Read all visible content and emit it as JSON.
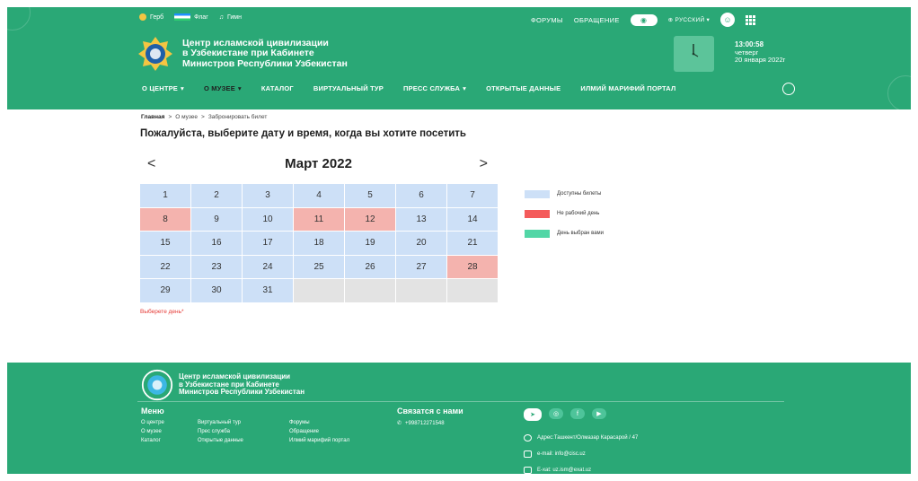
{
  "topbar": {
    "gerb": "Герб",
    "flag": "Флаг",
    "anthem": "Гимн",
    "forums": "ФОРУМЫ",
    "appeal": "ОБРАЩЕНИЕ",
    "lang": "⊕ РУССКИЙ ▾"
  },
  "brand": {
    "line1": "Центр исламской цивилизации",
    "line2": "в Узбекистане при Кабинете",
    "line3": "Министров Республики Узбекистан"
  },
  "clock": {
    "time": "13:00:58",
    "weekday": "четверг",
    "date": "20 января 2022г"
  },
  "nav": [
    {
      "label": "О ЦЕНТРЕ",
      "caret": "▾"
    },
    {
      "label": "О МУЗЕЕ",
      "caret": "▾"
    },
    {
      "label": "КАТАЛОГ",
      "caret": ""
    },
    {
      "label": "ВИРТУАЛЬНЫЙ ТУР",
      "caret": ""
    },
    {
      "label": "ПРЕСС СЛУЖБА",
      "caret": "▾"
    },
    {
      "label": "ОТКРЫТЫЕ ДАННЫЕ",
      "caret": ""
    },
    {
      "label": "ИЛМИЙ МАРИФИЙ ПОРТАЛ",
      "caret": ""
    }
  ],
  "breadcrumb": {
    "home": "Главная",
    "sep": ">",
    "museum": "О музее",
    "current": "Забронировать билет"
  },
  "page": {
    "title": "Пожалуйста, выберите дату и время, когда вы хотите посетить"
  },
  "calendar": {
    "prev": "<",
    "next": ">",
    "month": "Март 2022",
    "days": [
      "1",
      "2",
      "3",
      "4",
      "5",
      "6",
      "7",
      "8",
      "9",
      "10",
      "11",
      "12",
      "13",
      "14",
      "15",
      "16",
      "17",
      "18",
      "19",
      "20",
      "21",
      "22",
      "23",
      "24",
      "25",
      "26",
      "27",
      "28",
      "29",
      "30",
      "31"
    ],
    "closed_days": [
      "8",
      "11",
      "12",
      "28"
    ],
    "trailing_empty": 4,
    "warning": "Выберете день*"
  },
  "legend": [
    {
      "label": "Доступны билеты",
      "color": "#cde0f7"
    },
    {
      "label": "Не рабочий день",
      "color": "#f45b5b"
    },
    {
      "label": "День выбран вами",
      "color": "#52d6a6"
    }
  ],
  "footer": {
    "brand_line1": "Центр исламской цивилизации",
    "brand_line2": "в Узбекистане при Кабинете",
    "brand_line3": "Министров Республики Узбекистан",
    "menu_title": "Меню",
    "links": [
      "О центре",
      "Виртуальный тур",
      "Форумы",
      "О музее",
      "Прес служба",
      "Обращение",
      "Каталог",
      "Открытые данные",
      "Илмий марифий портал"
    ],
    "contact_title": "Связатся с нами",
    "phone": "+998712271548",
    "address": "Адрес:Ташкент/Олмазар Карасарой / 47",
    "email": "e-mail: info@cisc.uz",
    "exat": "E-xat: uz.ism@exat.uz"
  },
  "colors": {
    "primary": "#2aa876",
    "available": "#cde0f7",
    "closed": "#f4b3ae",
    "empty": "#e3e3e3",
    "warning": "#e53935"
  }
}
